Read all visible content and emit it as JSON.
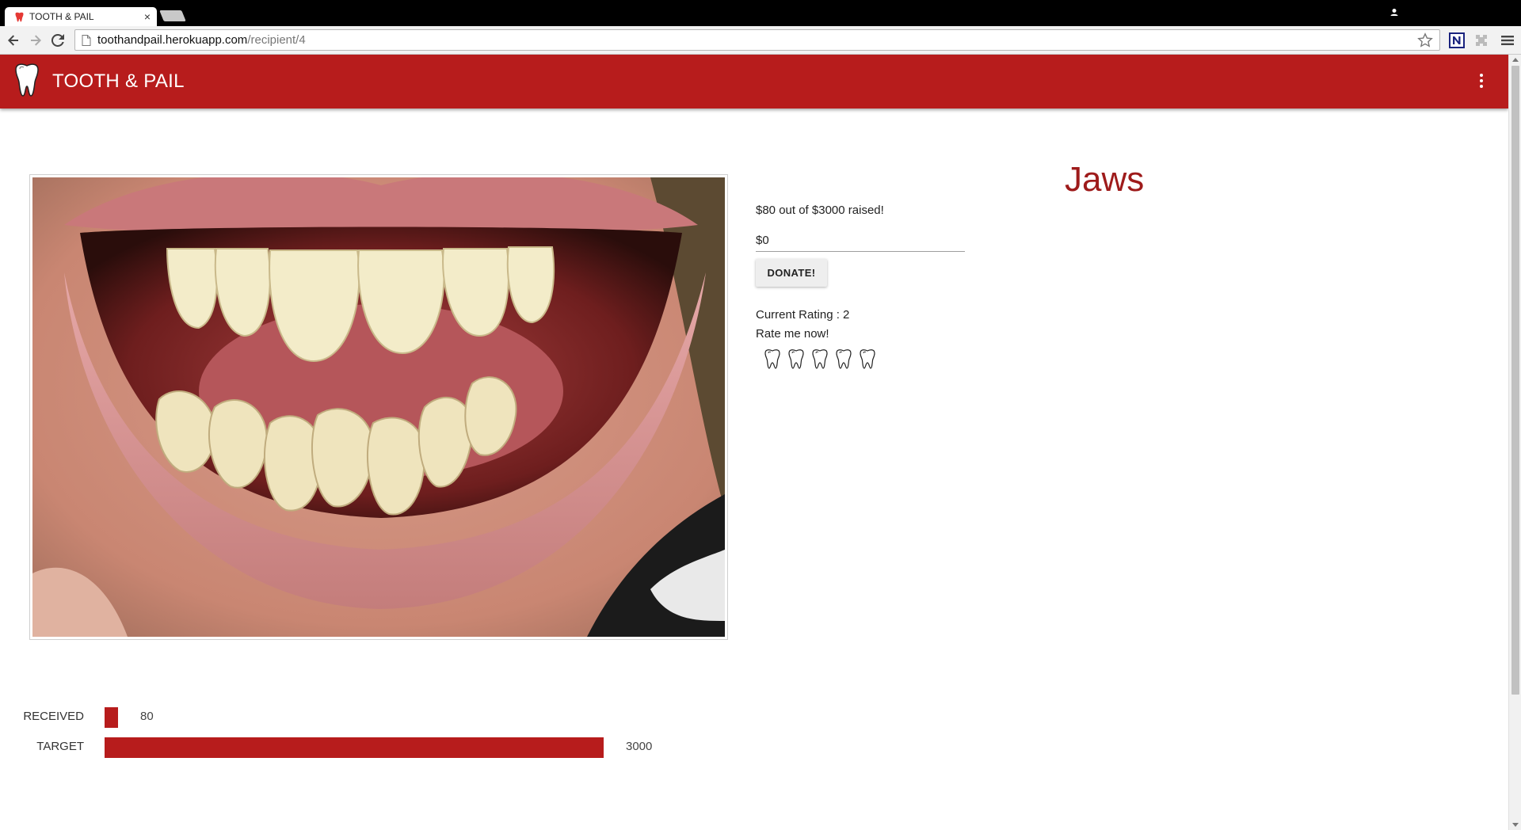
{
  "browser": {
    "tab_title": "TOOTH & PAIL",
    "tab_close": "×",
    "url_host": "toothandpail.herokuapp.com",
    "url_path": "/recipient/4",
    "icons": [
      "favicon-tooth-icon",
      "close-icon",
      "user-icon",
      "back-arrow-icon",
      "forward-arrow-icon",
      "reload-icon",
      "page-icon",
      "star-icon",
      "extension-n-icon",
      "extension-icon",
      "hamburger-menu-icon"
    ]
  },
  "app": {
    "brand": "TOOTH & PAIL",
    "accent_color": "#b71c1c",
    "icons": [
      "tooth-logo-icon",
      "more-vert-icon"
    ]
  },
  "recipient": {
    "name": "Jaws",
    "name_color": "#9e1b1b",
    "raised_text": "$80 out of $3000 raised!",
    "amount_value": "$0",
    "donate_label": "DONATE!",
    "rating_text": "Current Rating : 2",
    "rate_prompt": "Rate me now!",
    "rate_options": [
      1,
      2,
      3,
      4,
      5
    ],
    "photo_subject": "open mouth showing teeth"
  },
  "chart_data": {
    "type": "bar",
    "orientation": "horizontal",
    "categories": [
      "RECEIVED",
      "TARGET"
    ],
    "values": [
      80,
      3000
    ],
    "xlim": [
      0,
      3000
    ],
    "value_labels": [
      "80",
      "3000"
    ],
    "color": "#b71c1c",
    "grid": false
  }
}
